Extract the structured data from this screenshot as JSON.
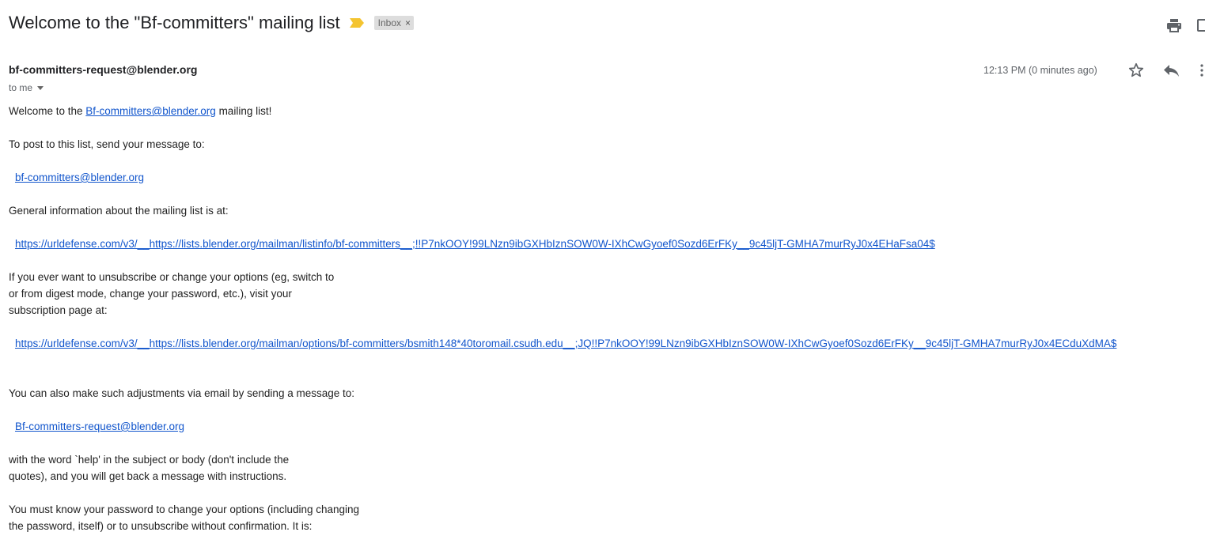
{
  "subject": "Welcome to the \"Bf-committers\" mailing list",
  "labels": {
    "inbox": "Inbox",
    "inbox_close": "×"
  },
  "sender": "bf-committers-request@blender.org",
  "recipient": "to me",
  "timestamp": "12:13 PM (0 minutes ago)",
  "colors": {
    "link": "#1155cc",
    "importance": "#f4c430",
    "label_bg": "#dddddd"
  },
  "icons": [
    "print-icon",
    "new-window-icon",
    "star-icon",
    "reply-icon",
    "more-icon",
    "importance-marker-icon"
  ],
  "body": {
    "welcome_prefix": "Welcome to the ",
    "welcome_link": "Bf-committers@blender.org",
    "welcome_suffix": " mailing list!",
    "post_instructions": "To post to this list, send your message to:",
    "post_address": "bf-committers@blender.org",
    "general_info": "General information about the mailing list is at:",
    "listinfo_url": "https://urldefense.com/v3/__https://lists.blender.org/mailman/listinfo/bf-committers__;!!P7nkOOY!99LNzn9ibGXHbIznSOW0W-IXhCwGyoef0Sozd6ErFKy__9c45ljT-GMHA7murRyJ0x4EHaFsa04$",
    "unsub_line1": "If you ever want to unsubscribe or change your options (eg, switch to",
    "unsub_line2": "or from digest mode, change your password, etc.), visit your",
    "unsub_line3": "subscription page at:",
    "options_url": "https://urldefense.com/v3/__https://lists.blender.org/mailman/options/bf-committers/bsmith148*40toromail.csudh.edu__;JQ!!P7nkOOY!99LNzn9ibGXHbIznSOW0W-IXhCwGyoef0Sozd6ErFKy__9c45ljT-GMHA7murRyJ0x4ECduXdMA$",
    "email_adjust": "You can also make such adjustments via email by sending a message to:",
    "request_address": "Bf-committers-request@blender.org",
    "help_line1": "with the word `help' in the subject or body (don't include the",
    "help_line2": "quotes), and you will get back a message with instructions.",
    "password_line1": "You must know your password to change your options (including changing",
    "password_line2": "the password, itself) or to unsubscribe without confirmation.  It is:"
  }
}
